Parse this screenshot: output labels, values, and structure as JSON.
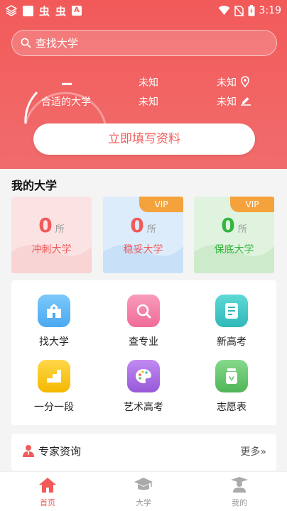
{
  "status_bar": {
    "time": "3:19",
    "glyph1": "虫",
    "glyph2": "虫",
    "badge": "A"
  },
  "search": {
    "placeholder": "查找大学"
  },
  "summary": {
    "score": "--",
    "score_label": "合适的大学",
    "col1_row1": "未知",
    "col1_row2": "未知",
    "col2_row1": "未知",
    "col2_row2": "未知",
    "icon_row1": "location-pin-icon",
    "icon_row2": "edit-pencil-icon"
  },
  "fill_button": {
    "label": "立即填写资料"
  },
  "my_universities": {
    "title": "我的大学",
    "cards": [
      {
        "count": "0",
        "unit": "所",
        "name": "冲刺大学",
        "vip": "",
        "color": "#f25a5a"
      },
      {
        "count": "0",
        "unit": "所",
        "name": "稳妥大学",
        "vip": "VIP",
        "color": "#f25a5a"
      },
      {
        "count": "0",
        "unit": "所",
        "name": "保底大学",
        "vip": "VIP",
        "color": "#33b540"
      }
    ]
  },
  "grid": {
    "items": [
      {
        "label": "找大学",
        "icon": "school-icon",
        "color": "#5ab8f5"
      },
      {
        "label": "查专业",
        "icon": "magnifier-icon",
        "color": "#f47fa4"
      },
      {
        "label": "新高考",
        "icon": "document-icon",
        "color": "#3fc8c8"
      },
      {
        "label": "一分一段",
        "icon": "steps-icon",
        "color": "#f6c21c"
      },
      {
        "label": "艺术高考",
        "icon": "palette-icon",
        "color": "#a86be0"
      },
      {
        "label": "志愿表",
        "icon": "jar-icon",
        "color": "#62c46a"
      }
    ]
  },
  "expert": {
    "title": "专家资询",
    "more": "更多»"
  },
  "tabbar": {
    "tabs": [
      {
        "label": "首页",
        "icon": "home-icon",
        "active": true
      },
      {
        "label": "大学",
        "icon": "graduation-cap-icon",
        "active": false
      },
      {
        "label": "我的",
        "icon": "profile-icon",
        "active": false
      }
    ]
  },
  "colors": {
    "brand": "#f25a5a",
    "vip": "#f4a23b"
  }
}
